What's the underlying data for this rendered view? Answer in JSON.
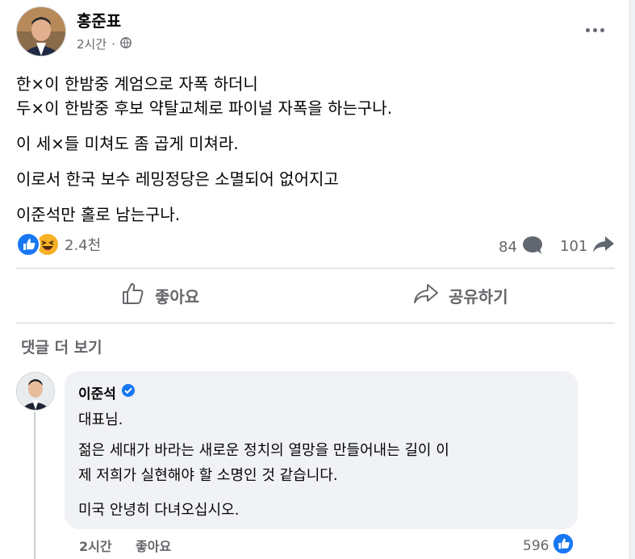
{
  "post": {
    "author": "홍준표",
    "time": "2시간",
    "lines": [
      "한×이 한밤중 계엄으로 자폭 하더니",
      "두×이 한밤중 후보 약탈교체로 파이널 자폭을 하는구나.",
      "이 세×들 미쳐도 좀 곱게 미쳐라.",
      "이로서 한국 보수 레밍정당은 소멸되어 없어지고",
      "이준석만 홀로 남는구나."
    ],
    "reaction_count": "2.4천",
    "comment_count": "84",
    "share_count": "101"
  },
  "actions": {
    "like": "좋아요",
    "share": "공유하기"
  },
  "comments_section": {
    "more": "댓글 더 보기"
  },
  "comment": {
    "author": "이준석",
    "lines": [
      "대표님.",
      "젊은 세대가 바라는 새로운 정치의 열망을 만들어내는 길이 이",
      "제 저희가 실현해야 할 소명인 것 같습니다.",
      "미국 안녕히 다녀오십시오."
    ],
    "time": "2시간",
    "like_label": "좋아요",
    "reaction_count": "596"
  },
  "colors": {
    "accent": "#1877f2",
    "secondary_text": "#65676b",
    "divider": "#ced0d4",
    "like_reaction": "#1877f2",
    "haha_reaction": "#f7b125"
  },
  "icons": [
    "globe-icon",
    "more-icon",
    "like-reaction-icon",
    "haha-reaction-icon",
    "comment-icon",
    "share-arrow-icon",
    "thumbs-up-icon",
    "share-icon",
    "verified-badge-icon"
  ]
}
